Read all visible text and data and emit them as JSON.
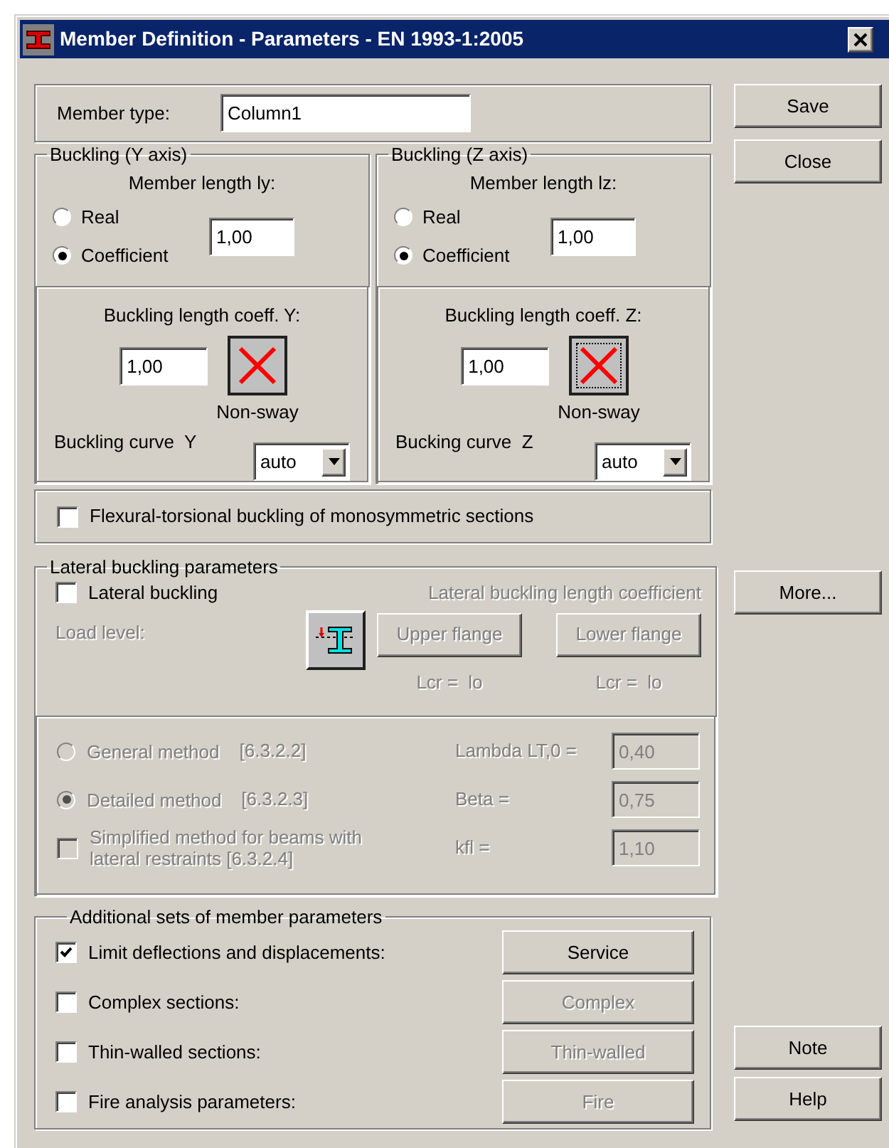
{
  "window": {
    "title": "Member Definition - Parameters - EN 1993-1:2005"
  },
  "member_type": {
    "label": "Member type:",
    "value": "Column1"
  },
  "buckling": [
    {
      "title": "Buckling (Y axis)",
      "length_label": "Member length ly:",
      "options": [
        {
          "label": "Real",
          "selected": false
        },
        {
          "label": "Coefficient",
          "selected": true
        }
      ],
      "length_value": "1,00",
      "coeff_label": "Buckling length coeff. Y:",
      "coeff_value": "1,00",
      "sway_label": "Non-sway",
      "focused": false,
      "curve_label": "Buckling curve  Y",
      "curve_value": "auto"
    },
    {
      "title": "Buckling (Z axis)",
      "length_label": "Member length lz:",
      "options": [
        {
          "label": "Real",
          "selected": false
        },
        {
          "label": "Coefficient",
          "selected": true
        }
      ],
      "length_value": "1,00",
      "coeff_label": "Buckling length coeff. Z:",
      "coeff_value": "1,00",
      "sway_label": "Non-sway",
      "focused": true,
      "curve_label": "Bucking curve  Z",
      "curve_value": "auto"
    }
  ],
  "flexural": {
    "label": "Flexural-torsional buckling of monosymmetric sections",
    "checked": false
  },
  "lateral": {
    "title": "Lateral buckling parameters",
    "checkbox": {
      "label": "Lateral buckling",
      "checked": false
    },
    "load_level": {
      "label": "Load level:",
      "disabled": true
    },
    "coeff_title": "Lateral buckling length coefficient",
    "flanges": [
      {
        "label": "Upper flange",
        "formula": "Lcr =  lo",
        "disabled": true
      },
      {
        "label": "Lower flange",
        "formula": "Lcr =  lo",
        "disabled": true
      }
    ],
    "methods": [
      {
        "kind": "radio",
        "label": "General method",
        "ref": "[6.3.2.2]",
        "selected": false,
        "disabled": true,
        "param_label": "Lambda LT,0 =",
        "param_value": "0,40"
      },
      {
        "kind": "radio",
        "label": "Detailed method",
        "ref": "[6.3.2.3]",
        "selected": true,
        "disabled": true,
        "param_label": "Beta =",
        "param_value": "0,75"
      },
      {
        "kind": "checkbox",
        "label": "Simplified method for beams with lateral restraints [6.3.2.4]",
        "checked": false,
        "disabled": true,
        "param_label": "kfl =",
        "param_value": "1,10"
      }
    ]
  },
  "additional": {
    "title": "Additional sets of member parameters",
    "items": [
      {
        "label": "Limit deflections and displacements:",
        "checked": true,
        "button": "Service",
        "disabled": false
      },
      {
        "label": "Complex sections:",
        "checked": false,
        "button": "Complex",
        "disabled": true
      },
      {
        "label": "Thin-walled sections:",
        "checked": false,
        "button": "Thin-walled",
        "disabled": true
      },
      {
        "label": "Fire analysis parameters:",
        "checked": false,
        "button": "Fire",
        "disabled": true
      }
    ]
  },
  "side_buttons": {
    "top": [
      "Save",
      "Close"
    ],
    "middle": [
      "More..."
    ],
    "bottom": [
      "Note",
      "Help"
    ]
  }
}
